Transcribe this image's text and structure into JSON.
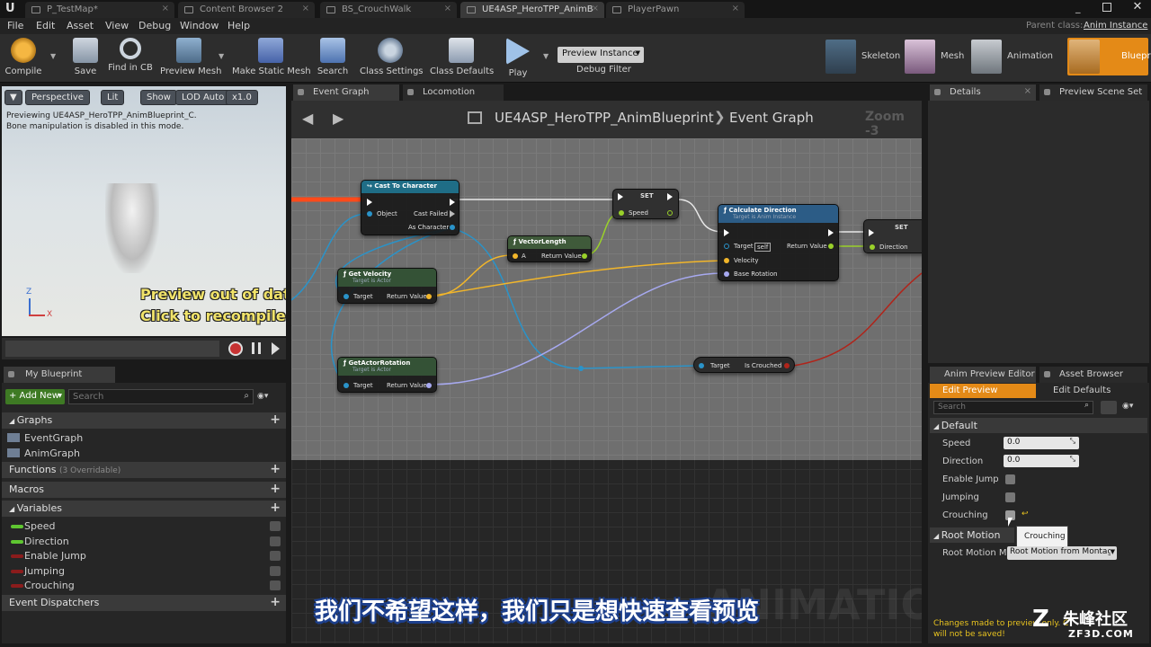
{
  "document_tabs": [
    {
      "label": "P_TestMap*"
    },
    {
      "label": "Content Browser 2"
    },
    {
      "label": "BS_CrouchWalk"
    },
    {
      "label": "UE4ASP_HeroTPP_AnimB"
    },
    {
      "label": "PlayerPawn"
    }
  ],
  "parent_class": {
    "label": "Parent class:",
    "value": "Anim Instance"
  },
  "menu": [
    "File",
    "Edit",
    "Asset",
    "View",
    "Debug",
    "Window",
    "Help"
  ],
  "toolbar": {
    "buttons": [
      "Compile",
      "Save",
      "Find in CB",
      "Preview Mesh",
      "Make Static Mesh",
      "Search",
      "Class Settings",
      "Class Defaults",
      "Play"
    ],
    "preview_instance": "Preview Instance",
    "debug_filter": "Debug Filter"
  },
  "modes": [
    "Skeleton",
    "Mesh",
    "Animation",
    "Blueprint"
  ],
  "viewport": {
    "buttons": [
      "Perspective",
      "Lit",
      "Show",
      "LOD Auto",
      "x1.0"
    ],
    "info_line1": "Previewing UE4ASP_HeroTPP_AnimBlueprint_C.",
    "info_line2": "Bone manipulation is disabled in this mode.",
    "warning_line1": "Preview out of date",
    "warning_line2": "Click to recompile",
    "axis_z": "Z",
    "axis_x": "X"
  },
  "my_blueprint": {
    "tab": "My Blueprint",
    "add_new": "+ Add New",
    "search_placeholder": "Search",
    "graphs_header": "Graphs",
    "graphs": [
      "EventGraph",
      "AnimGraph"
    ],
    "functions_header": "Functions",
    "functions_note": "(3 Overridable)",
    "macros_header": "Macros",
    "variables_header": "Variables",
    "variables": [
      {
        "name": "Speed",
        "color": "#5fc631"
      },
      {
        "name": "Direction",
        "color": "#5fc631"
      },
      {
        "name": "Enable Jump",
        "color": "#8b1c1c"
      },
      {
        "name": "Jumping",
        "color": "#8b1c1c"
      },
      {
        "name": "Crouching",
        "color": "#8b1c1c"
      }
    ],
    "dispatchers_header": "Event Dispatchers"
  },
  "graph_tabs": [
    "Event Graph",
    "Locomotion"
  ],
  "breadcrumb": {
    "asset": "UE4ASP_HeroTPP_AnimBlueprint",
    "graph": "Event Graph",
    "zoom": "Zoom -3"
  },
  "nodes": {
    "cast": {
      "title": "Cast To Character",
      "pins": [
        "Object",
        "Cast Failed",
        "As Character"
      ]
    },
    "set1": {
      "title": "SET",
      "pins": [
        "Speed"
      ]
    },
    "vlen": {
      "title": "VectorLength",
      "pins": [
        "A",
        "Return Value"
      ]
    },
    "calc": {
      "title": "Calculate Direction",
      "subtitle": "Target is Anim Instance",
      "pins": [
        "Target",
        "self",
        "Return Value",
        "Velocity",
        "Base Rotation"
      ]
    },
    "set2": {
      "title": "SET",
      "pins": [
        "Direction"
      ]
    },
    "getvel": {
      "title": "Get Velocity",
      "subtitle": "Target is Actor",
      "pins": [
        "Target",
        "Return Value"
      ]
    },
    "getrot": {
      "title": "GetActorRotation",
      "subtitle": "Target is Actor",
      "pins": [
        "Target",
        "Return Value"
      ]
    },
    "crouched": {
      "pins": [
        "Target",
        "Is Crouched"
      ]
    }
  },
  "watermark": "ANIMATION",
  "right_tabs": [
    "Details",
    "Preview Scene Set"
  ],
  "bottom_tabs": [
    "Anim Preview Editor",
    "Asset Browser"
  ],
  "edit_preview": "Edit Preview",
  "edit_defaults": "Edit Defaults",
  "details": {
    "search_placeholder": "Search",
    "default_header": "Default",
    "rows": [
      {
        "label": "Speed",
        "value": "0.0"
      },
      {
        "label": "Direction",
        "value": "0.0"
      },
      {
        "label": "Enable Jump"
      },
      {
        "label": "Jumping"
      },
      {
        "label": "Crouching"
      }
    ],
    "tooltip": "Crouching",
    "root_motion_header": "Root Motion",
    "root_motion_label": "Root Motion Mo",
    "root_motion_value": "Root Motion from Montag",
    "warning": "Changes made to preview only. C",
    "warning2": "will not be saved!"
  },
  "subtitle": "我们不希望这样，我们只是想快速查看预览",
  "brand": {
    "name": "朱峰社区",
    "url": "ZF3D.COM"
  }
}
